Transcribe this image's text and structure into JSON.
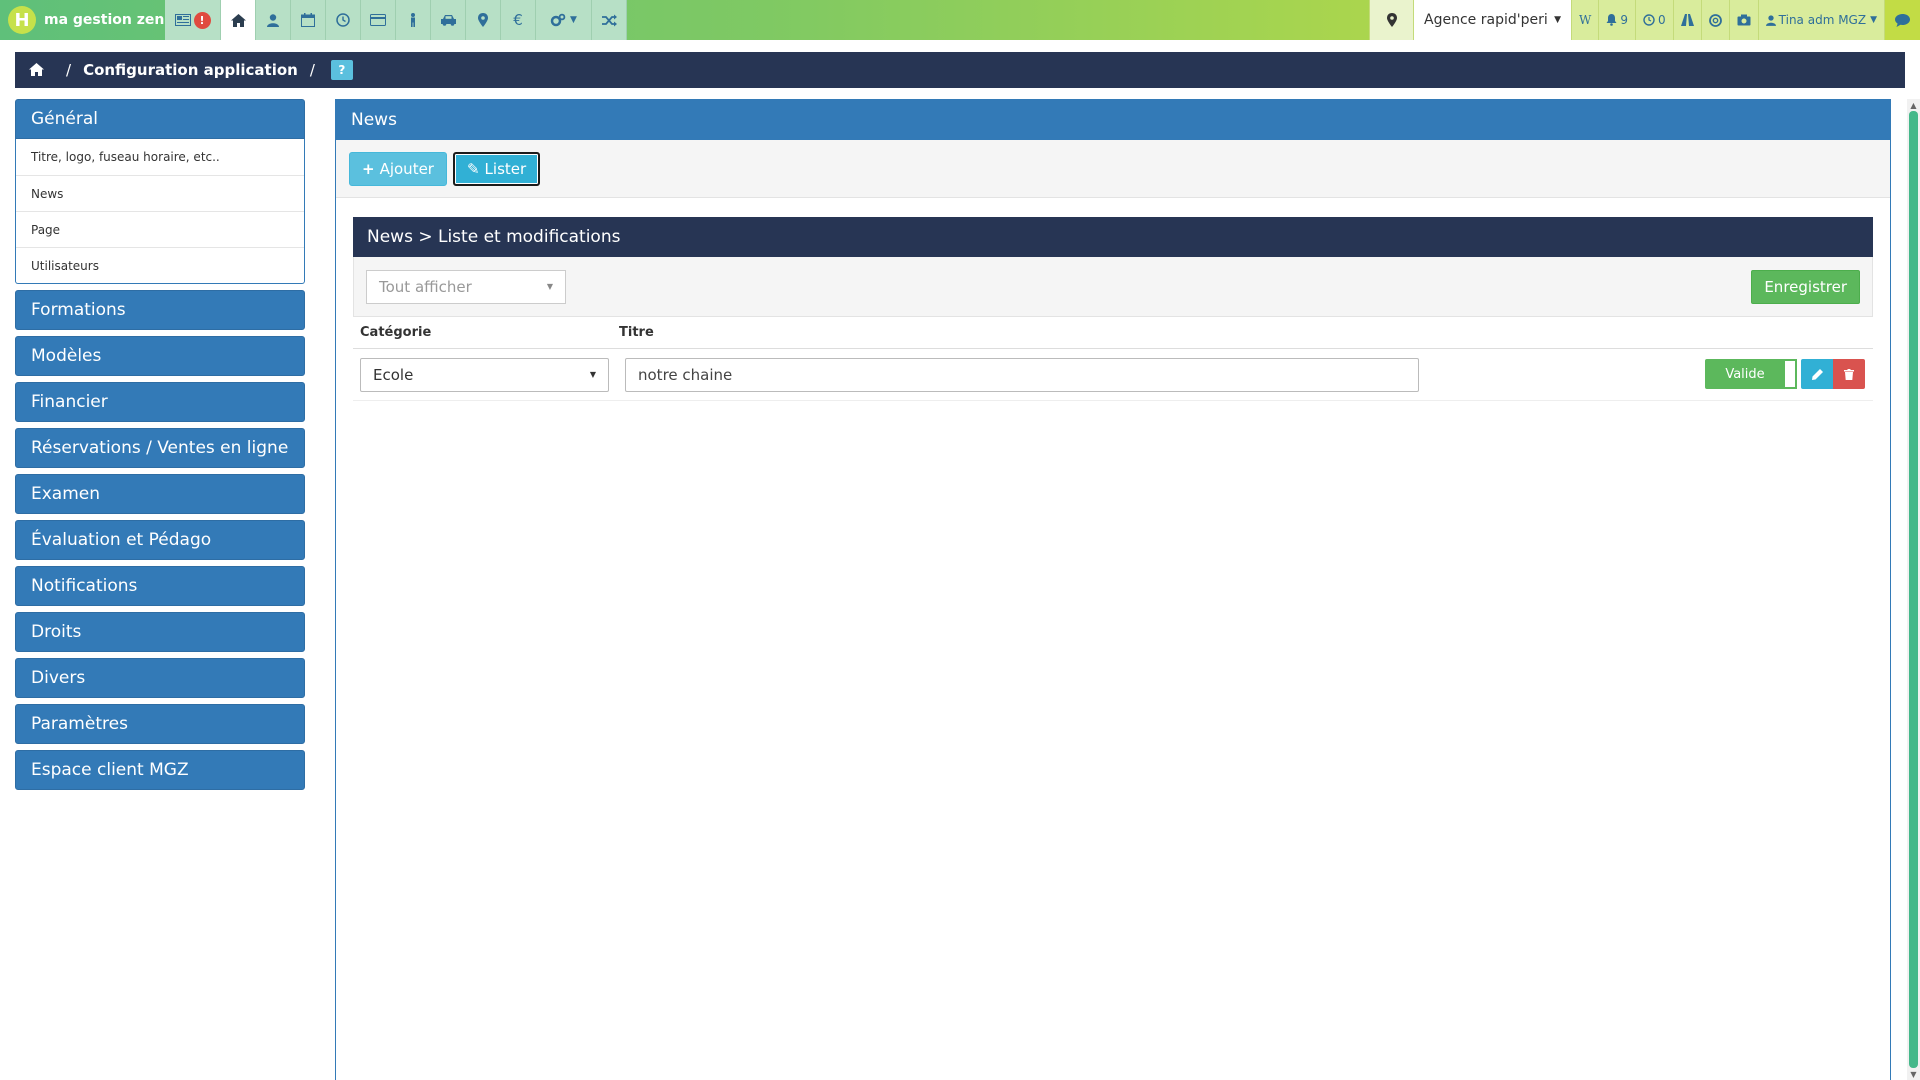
{
  "brand": {
    "logo_letter": "H",
    "name": "ma gestion zen"
  },
  "nav": {
    "icons": [
      "news-alert-icon",
      "home-icon",
      "user-icon",
      "calendar-icon",
      "clock-icon",
      "card-icon",
      "person-icon",
      "car-icon",
      "map-pin-icon",
      "euro-icon",
      "cogs-icon",
      "shuffle-icon"
    ],
    "alert_badge": "!"
  },
  "topbar_right": {
    "agency": "Agence rapid'peri",
    "w_label": "W",
    "notifications_count": "9",
    "timer_count": "0",
    "user_name": "Tina adm MGZ"
  },
  "breadcrumb": {
    "title": "Configuration application",
    "sep": "/",
    "help": "?"
  },
  "sidebar": {
    "general": {
      "label": "Général",
      "items": [
        "Titre, logo, fuseau horaire, etc..",
        "News",
        "Page",
        "Utilisateurs"
      ]
    },
    "groups": [
      "Formations",
      "Modèles",
      "Financier",
      "Réservations / Ventes en ligne",
      "Examen",
      "Évaluation et Pédago",
      "Notifications",
      "Droits",
      "Divers",
      "Paramètres",
      "Espace client MGZ"
    ]
  },
  "panel": {
    "title": "News",
    "add_label": "Ajouter",
    "list_label": "Lister",
    "add_icon": "+",
    "list_icon": "✎"
  },
  "subpanel": {
    "title": "News > Liste et modifications",
    "filter_value": "Tout afficher",
    "save_label": "Enregistrer",
    "col_category": "Catégorie",
    "col_title": "Titre",
    "rows": [
      {
        "category": "Ecole",
        "title": "notre chaine",
        "status": "Valide"
      }
    ]
  },
  "colors": {
    "primary": "#337ab7",
    "dark": "#273554",
    "success": "#5cb85c",
    "info": "#5bc0de",
    "danger": "#d9534f"
  }
}
